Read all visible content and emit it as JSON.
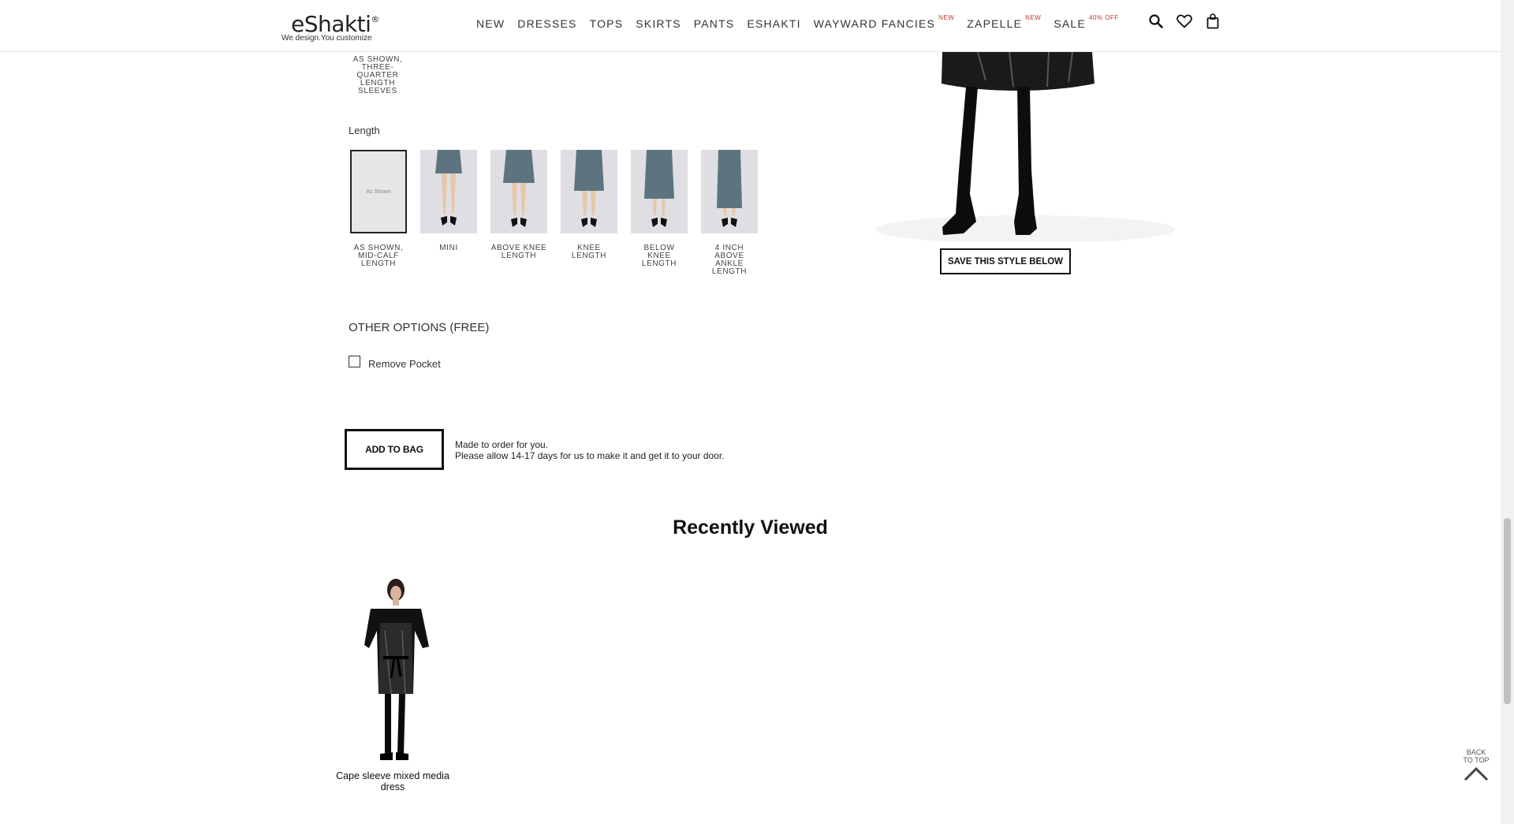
{
  "header": {
    "logo_text": "eShakti",
    "logo_mark": "®",
    "logo_tagline": "We design.You customize",
    "nav": [
      {
        "label": "NEW",
        "badge": ""
      },
      {
        "label": "DRESSES",
        "badge": ""
      },
      {
        "label": "TOPS",
        "badge": ""
      },
      {
        "label": "SKIRTS",
        "badge": ""
      },
      {
        "label": "PANTS",
        "badge": ""
      },
      {
        "label": "ESHAKTI",
        "badge": ""
      },
      {
        "label": "WAYWARD FANCIES",
        "badge": "NEW"
      },
      {
        "label": "ZAPELLE",
        "badge": "NEW"
      },
      {
        "label": "SALE",
        "badge": "40% OFF"
      }
    ],
    "icons": [
      "search-icon",
      "heart-icon",
      "shopping-bag-icon"
    ]
  },
  "sleeve": {
    "selected_caption": "AS SHOWN, THREE-QUARTER LENGTH SLEEVES"
  },
  "length": {
    "label": "Length",
    "options": [
      {
        "caption": "AS SHOWN, MID-CALF LENGTH",
        "image_text": "As Shown",
        "selected": true
      },
      {
        "caption": "MINI",
        "image_text": "",
        "selected": false
      },
      {
        "caption": "ABOVE KNEE LENGTH",
        "image_text": "",
        "selected": false
      },
      {
        "caption": "KNEE LENGTH",
        "image_text": "",
        "selected": false
      },
      {
        "caption": "BELOW KNEE LENGTH",
        "image_text": "",
        "selected": false
      },
      {
        "caption": "4 INCH ABOVE ANKLE LENGTH",
        "image_text": "",
        "selected": false
      }
    ]
  },
  "other_options": {
    "title": "OTHER OPTIONS (FREE)",
    "remove_pocket_label": "Remove Pocket",
    "remove_pocket_checked": false
  },
  "purchase": {
    "add_to_bag_label": "ADD TO BAG",
    "note_line1": "Made to order for you.",
    "note_line2": "Please allow 14-17 days for us to make it and get it to your door."
  },
  "product": {
    "save_style_label": "SAVE THIS STYLE BELOW"
  },
  "recently_viewed": {
    "title": "Recently Viewed",
    "items": [
      {
        "name": "Cape sleeve mixed media dress"
      }
    ]
  },
  "back_to_top": {
    "label_line1": "BACK",
    "label_line2": "TO TOP"
  },
  "colors": {
    "accent_badge": "#c0392b",
    "swatch_dress": "#5d7480",
    "text": "#222222"
  }
}
